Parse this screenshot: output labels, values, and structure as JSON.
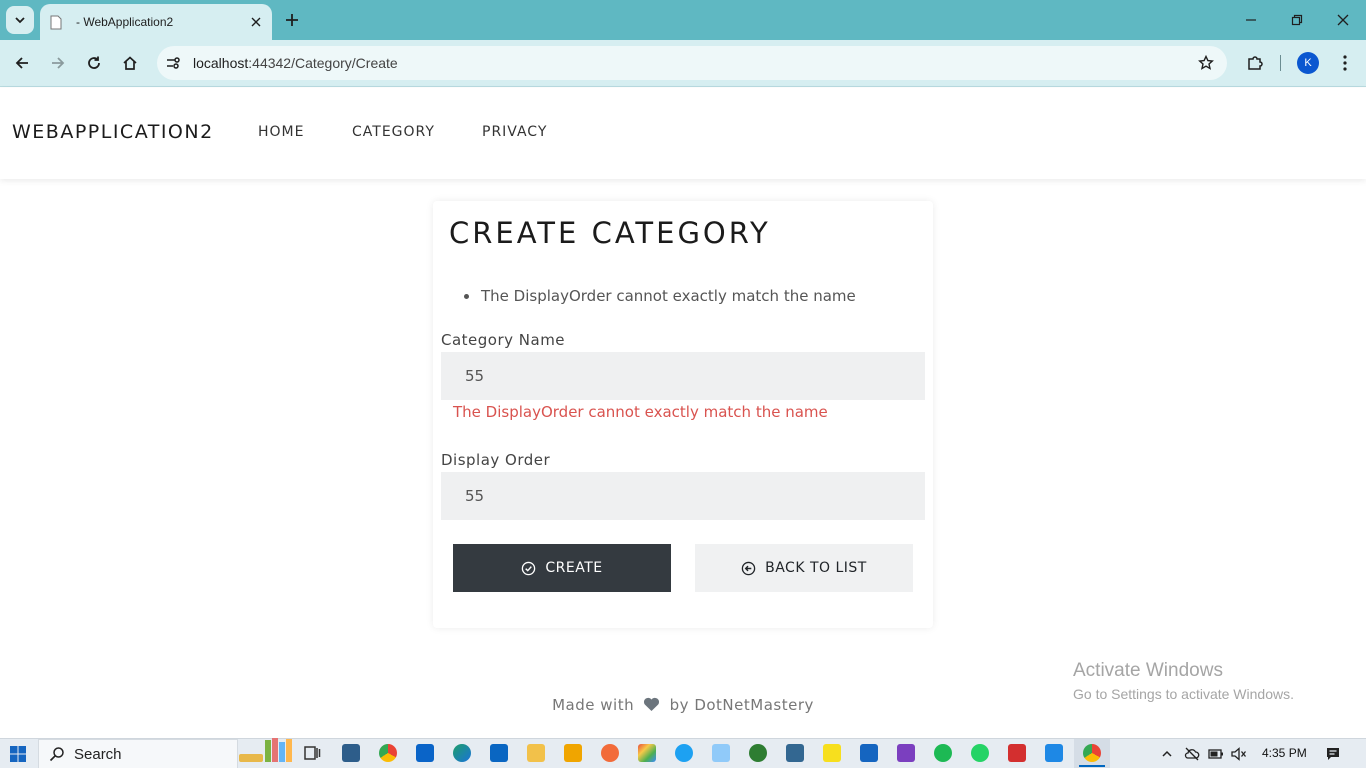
{
  "browser": {
    "tab_title": "- WebApplication2",
    "url_host": "localhost",
    "url_rest": ":44342/Category/Create",
    "profile_initial": "K"
  },
  "site": {
    "brand": "WEBAPPLICATION2",
    "nav": [
      "HOME",
      "CATEGORY",
      "PRIVACY"
    ]
  },
  "form": {
    "title": "CREATE CATEGORY",
    "validation_summary": [
      "The DisplayOrder cannot exactly match the name"
    ],
    "name_label": "Category Name",
    "name_value": "55",
    "name_error": "The DisplayOrder cannot exactly match the name",
    "order_label": "Display Order",
    "order_value": "55",
    "create_label": "CREATE",
    "back_label": "BACK TO LIST"
  },
  "footer": {
    "before": "Made with",
    "after": "by DotNetMastery"
  },
  "watermark": {
    "title": "Activate Windows",
    "subtitle": "Go to Settings to activate Windows."
  },
  "taskbar": {
    "search_label": "Search",
    "time": "4:35 PM",
    "apps": [
      "file-explorer-icon",
      "chrome-icon",
      "outlook-icon",
      "edge-icon",
      "linkedin-icon",
      "folder-icon",
      "store-icon",
      "app-icon",
      "git-icon",
      "skype-icon",
      "notepad-icon",
      "mongodb-icon",
      "postgres-icon",
      "editor-icon",
      "terminal-icon",
      "visual-studio-icon",
      "spotify-icon",
      "whatsapp-icon",
      "acrobat-icon",
      "photos-icon",
      "chrome-active-icon"
    ]
  },
  "colors": {
    "tab_bar": "#5fb8c2",
    "toolbar": "#d6eef1",
    "primary_button": "#343a40",
    "error": "#d9534f",
    "input_bg": "#eff0f1"
  }
}
